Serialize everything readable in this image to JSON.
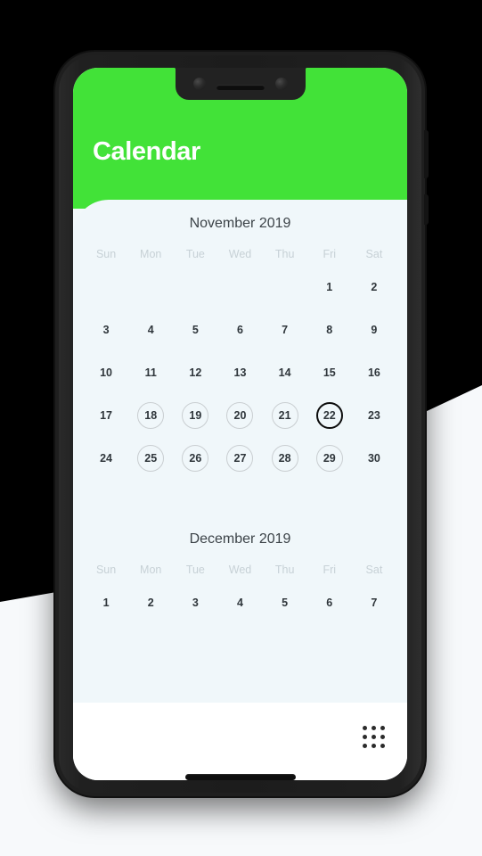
{
  "app": {
    "title": "Calendar",
    "accent_color": "#42e238",
    "card_background": "#f0f7fa",
    "bottom_bar_background": "#ffffff",
    "day_text_color": "#2f363b",
    "weekday_text_color": "#c7d1d6",
    "ring_color": "#c9ced1",
    "today_ring_color": "#0b0b0b"
  },
  "weekdays": [
    "Sun",
    "Mon",
    "Tue",
    "Wed",
    "Thu",
    "Fri",
    "Sat"
  ],
  "months": [
    {
      "title": "November 2019",
      "weeks": [
        [
          {
            "label": "",
            "state": "empty"
          },
          {
            "label": "",
            "state": "empty"
          },
          {
            "label": "",
            "state": "empty"
          },
          {
            "label": "",
            "state": "empty"
          },
          {
            "label": "",
            "state": "empty"
          },
          {
            "label": "1",
            "state": "plain"
          },
          {
            "label": "2",
            "state": "plain"
          }
        ],
        [
          {
            "label": "3",
            "state": "plain"
          },
          {
            "label": "4",
            "state": "plain"
          },
          {
            "label": "5",
            "state": "plain"
          },
          {
            "label": "6",
            "state": "plain"
          },
          {
            "label": "7",
            "state": "plain"
          },
          {
            "label": "8",
            "state": "plain"
          },
          {
            "label": "9",
            "state": "plain"
          }
        ],
        [
          {
            "label": "10",
            "state": "plain"
          },
          {
            "label": "11",
            "state": "plain"
          },
          {
            "label": "12",
            "state": "plain"
          },
          {
            "label": "13",
            "state": "plain"
          },
          {
            "label": "14",
            "state": "plain"
          },
          {
            "label": "15",
            "state": "plain"
          },
          {
            "label": "16",
            "state": "plain"
          }
        ],
        [
          {
            "label": "17",
            "state": "plain"
          },
          {
            "label": "18",
            "state": "ring"
          },
          {
            "label": "19",
            "state": "ring"
          },
          {
            "label": "20",
            "state": "ring"
          },
          {
            "label": "21",
            "state": "ring"
          },
          {
            "label": "22",
            "state": "today"
          },
          {
            "label": "23",
            "state": "plain"
          }
        ],
        [
          {
            "label": "24",
            "state": "plain"
          },
          {
            "label": "25",
            "state": "ring"
          },
          {
            "label": "26",
            "state": "ring"
          },
          {
            "label": "27",
            "state": "ring"
          },
          {
            "label": "28",
            "state": "ring"
          },
          {
            "label": "29",
            "state": "ring"
          },
          {
            "label": "30",
            "state": "plain"
          }
        ]
      ]
    },
    {
      "title": "December 2019",
      "weeks": [
        [
          {
            "label": "1",
            "state": "plain"
          },
          {
            "label": "2",
            "state": "plain"
          },
          {
            "label": "3",
            "state": "plain"
          },
          {
            "label": "4",
            "state": "plain"
          },
          {
            "label": "5",
            "state": "plain"
          },
          {
            "label": "6",
            "state": "plain"
          },
          {
            "label": "7",
            "state": "plain"
          }
        ]
      ]
    }
  ],
  "bottom_bar": {
    "apps_grid_icon": "apps-grid-icon"
  }
}
